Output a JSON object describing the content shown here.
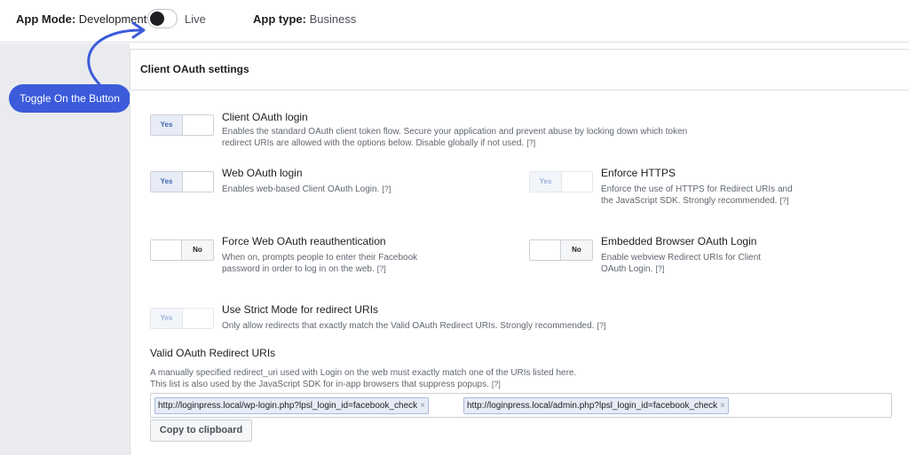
{
  "topbar": {
    "app_mode_label": "App Mode:",
    "app_mode_value": "Development",
    "live_label": "Live",
    "app_type_label": "App type:",
    "app_type_value": "Business"
  },
  "callout": {
    "text": "Toggle On the Button",
    "color": "#3b5bdb"
  },
  "panel": {
    "title": "Client OAuth settings"
  },
  "switch_labels": {
    "yes": "Yes",
    "no": "No"
  },
  "help_marker": "[?]",
  "options": {
    "client_oauth": {
      "title": "Client OAuth login",
      "desc": "Enables the standard OAuth client token flow. Secure your application and prevent abuse by locking down which token redirect URIs are allowed with the options below. Disable globally if not used.",
      "state": "Yes"
    },
    "web_oauth": {
      "title": "Web OAuth login",
      "desc": "Enables web-based Client OAuth Login.",
      "state": "Yes"
    },
    "enforce_https": {
      "title": "Enforce HTTPS",
      "desc": "Enforce the use of HTTPS for Redirect URIs and the JavaScript SDK. Strongly recommended.",
      "state": "Yes"
    },
    "force_reauth": {
      "title": "Force Web OAuth reauthentication",
      "desc": "When on, prompts people to enter their Facebook password in order to log in on the web.",
      "state": "No"
    },
    "embedded_browser": {
      "title": "Embedded Browser OAuth Login",
      "desc": "Enable webview Redirect URIs for Client OAuth Login.",
      "state": "No"
    },
    "strict_mode": {
      "title": "Use Strict Mode for redirect URIs",
      "desc": "Only allow redirects that exactly match the Valid OAuth Redirect URIs. Strongly recommended.",
      "state": "Yes"
    }
  },
  "redirect_uris": {
    "title": "Valid OAuth Redirect URIs",
    "desc_line1": "A manually specified redirect_uri used with Login on the web must exactly match one of the URIs listed here.",
    "desc_line2": "This list is also used by the JavaScript SDK for in-app browsers that suppress popups.",
    "uris": [
      "http://loginpress.local/wp-login.php?lpsl_login_id=facebook_check",
      "http://loginpress.local/admin.php?lpsl_login_id=facebook_check"
    ],
    "remove_glyph": "×",
    "copy_button": "Copy to clipboard"
  }
}
